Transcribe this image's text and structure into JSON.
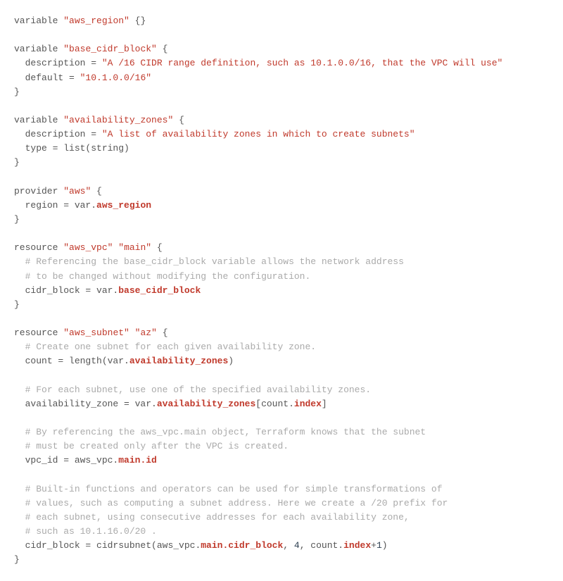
{
  "code": {
    "l1": {
      "kw": "variable",
      "name": "\"aws_region\"",
      "rest": " {}"
    },
    "l3": {
      "kw": "variable",
      "name": "\"base_cidr_block\"",
      "rest": " {"
    },
    "l4": {
      "key": "  description = ",
      "val": "\"A /16 CIDR range definition, such as 10.1.0.0/16, that the VPC will use\""
    },
    "l5": {
      "key": "  default = ",
      "val": "\"10.1.0.0/16\""
    },
    "l6": {
      "text": "}"
    },
    "l8": {
      "kw": "variable",
      "name": "\"availability_zones\"",
      "rest": " {"
    },
    "l9": {
      "key": "  description = ",
      "val": "\"A list of availability zones in which to create subnets\""
    },
    "l10": {
      "text": "  type = list(string)"
    },
    "l11": {
      "text": "}"
    },
    "l13": {
      "kw": "provider",
      "name": "\"aws\"",
      "rest": " {"
    },
    "l14": {
      "key": "  region = var.",
      "attr": "aws_region"
    },
    "l15": {
      "text": "}"
    },
    "l17": {
      "kw": "resource",
      "name1": "\"aws_vpc\"",
      "name2": "\"main\"",
      "rest": " {"
    },
    "l18": {
      "cmt": "  # Referencing the base_cidr_block variable allows the network address"
    },
    "l19": {
      "cmt": "  # to be changed without modifying the configuration."
    },
    "l20": {
      "key": "  cidr_block = var.",
      "attr": "base_cidr_block"
    },
    "l21": {
      "text": "}"
    },
    "l23": {
      "kw": "resource",
      "name1": "\"aws_subnet\"",
      "name2": "\"az\"",
      "rest": " {"
    },
    "l24": {
      "cmt": "  # Create one subnet for each given availability zone."
    },
    "l25": {
      "key": "  count = length(var.",
      "attr": "availability_zones",
      "after": ")"
    },
    "l27": {
      "cmt": "  # For each subnet, use one of the specified availability zones."
    },
    "l28": {
      "key": "  availability_zone = var.",
      "attr": "availability_zones",
      "mid": "[count.",
      "attr2": "index",
      "after": "]"
    },
    "l30": {
      "cmt": "  # By referencing the aws_vpc.main object, Terraform knows that the subnet"
    },
    "l31": {
      "cmt": "  # must be created only after the VPC is created."
    },
    "l32": {
      "key": "  vpc_id = aws_vpc.",
      "attr": "main.id"
    },
    "l34": {
      "cmt": "  # Built-in functions and operators can be used for simple transformations of"
    },
    "l35": {
      "cmt": "  # values, such as computing a subnet address. Here we create a /20 prefix for"
    },
    "l36": {
      "cmt": "  # each subnet, using consecutive addresses for each availability zone,"
    },
    "l37": {
      "cmt": "  # such as 10.1.16.0/20 ."
    },
    "l38": {
      "key": "  cidr_block = cidrsubnet(aws_vpc.",
      "attr": "main.cidr_block",
      "mid": ", ",
      "num1": "4",
      "mid2": ", count.",
      "attr2": "index",
      "plus": "+",
      "num2": "1",
      "after": ")"
    },
    "l39": {
      "text": "}"
    }
  }
}
